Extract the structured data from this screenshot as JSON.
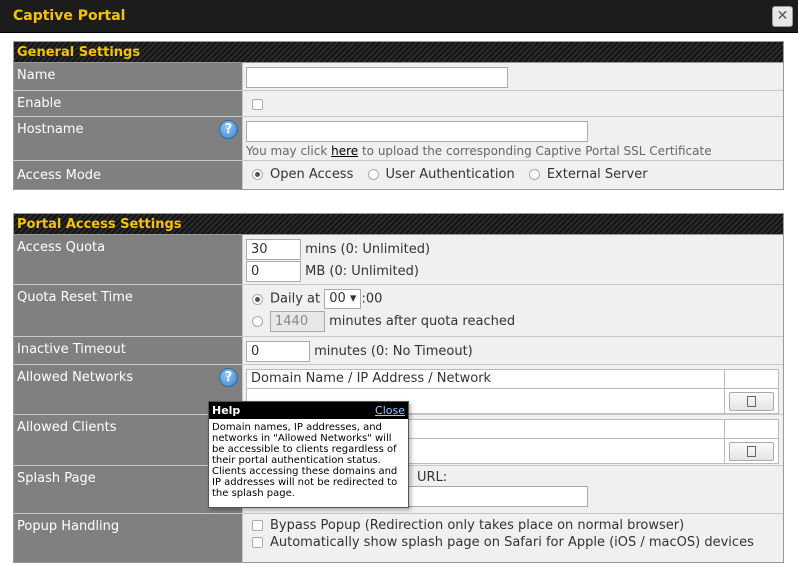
{
  "window": {
    "title": "Captive Portal",
    "close_glyph": "✕"
  },
  "general": {
    "header": "General Settings",
    "name": {
      "label": "Name",
      "value": ""
    },
    "enable": {
      "label": "Enable",
      "checked": false
    },
    "hostname": {
      "label": "Hostname",
      "value": "",
      "note_prefix": "You may click ",
      "note_link": "here",
      "note_suffix": " to upload the corresponding Captive Portal SSL Certificate"
    },
    "access_mode": {
      "label": "Access Mode",
      "options": [
        "Open Access",
        "User Authentication",
        "External Server"
      ],
      "selected": "Open Access"
    }
  },
  "portal": {
    "header": "Portal Access Settings",
    "access_quota": {
      "label": "Access Quota",
      "mins_value": "30",
      "mins_unit": "mins (0: Unlimited)",
      "mb_value": "0",
      "mb_unit": "MB (0: Unlimited)"
    },
    "quota_reset": {
      "label": "Quota Reset Time",
      "daily_label": "Daily at",
      "daily_hour": "00",
      "daily_minute_suffix": ":00",
      "minutes_value": "1440",
      "minutes_suffix": "minutes after quota reached"
    },
    "inactive_timeout": {
      "label": "Inactive Timeout",
      "value": "0",
      "suffix": "minutes (0: No Timeout)"
    },
    "allowed_networks": {
      "label": "Allowed Networks",
      "column": "Domain Name / IP Address / Network"
    },
    "allowed_clients": {
      "label": "Allowed Clients"
    },
    "splash_page": {
      "label": "Splash Page",
      "url_label_visible": "URL:",
      "value": ""
    },
    "popup_handling": {
      "label": "Popup Handling",
      "options": [
        "Bypass Popup (Redirection only takes place on normal browser)",
        "Automatically show splash page on Safari for Apple (iOS / macOS) devices"
      ]
    }
  },
  "tooltip": {
    "title": "Help",
    "close": "Close",
    "lines": [
      "Domain names, IP addresses, and",
      "networks in \"Allowed Networks\" will",
      "be accessible to clients regardless of",
      "their portal authentication status.",
      "Clients accessing these domains and",
      "IP addresses will not be redirected to",
      "the splash page."
    ]
  },
  "colors": {
    "accent": "#f5c400",
    "label_bg": "#808080",
    "value_bg": "#f0f0f0",
    "header_bg": "#1c1c1c"
  }
}
